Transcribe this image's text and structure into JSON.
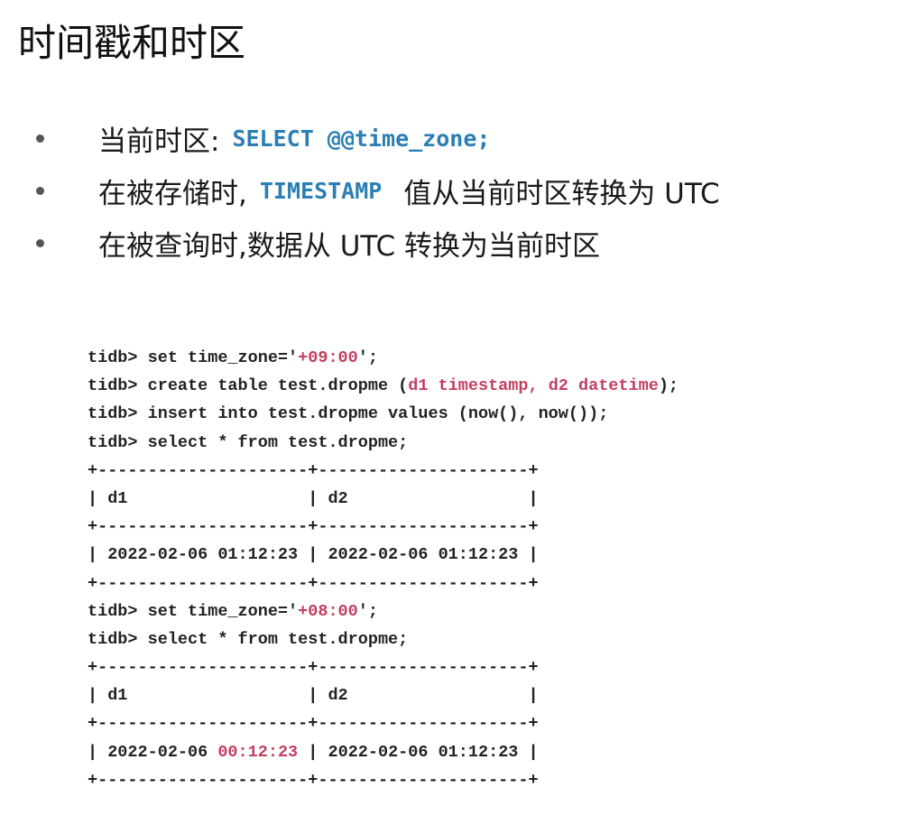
{
  "title": "时间戳和时区",
  "bullets": [
    {
      "text": "当前时区:",
      "code": "SELECT @@time_zone;",
      "after": ""
    },
    {
      "text": "在被存储时,",
      "code": "TIMESTAMP",
      "after": "值从当前时区转换为 UTC"
    },
    {
      "text": "在被查询时,数据从 UTC 转换为当前时区",
      "code": "",
      "after": ""
    }
  ],
  "code_lines": [
    [
      {
        "t": "tidb> set time_zone='"
      },
      {
        "t": "+09:00",
        "c": "pink"
      },
      {
        "t": "';"
      }
    ],
    [
      {
        "t": "tidb> create table test.dropme ("
      },
      {
        "t": "d1 timestamp, d2 datetime",
        "c": "pink"
      },
      {
        "t": ");"
      }
    ],
    [
      {
        "t": "tidb> insert into test.dropme values (now(), now());"
      }
    ],
    [
      {
        "t": "tidb> select * from test.dropme;"
      }
    ],
    [
      {
        "t": "+---------------------+---------------------+"
      }
    ],
    [
      {
        "t": "| d1                  | d2                  |"
      }
    ],
    [
      {
        "t": "+---------------------+---------------------+"
      }
    ],
    [
      {
        "t": "| 2022-02-06 01:12:23 | 2022-02-06 01:12:23 |"
      }
    ],
    [
      {
        "t": "+---------------------+---------------------+"
      }
    ],
    [
      {
        "t": "tidb> set time_zone='"
      },
      {
        "t": "+08:00",
        "c": "pink"
      },
      {
        "t": "';"
      }
    ],
    [
      {
        "t": "tidb> select * from test.dropme;"
      }
    ],
    [
      {
        "t": "+---------------------+---------------------+"
      }
    ],
    [
      {
        "t": "| d1                  | d2                  |"
      }
    ],
    [
      {
        "t": "+---------------------+---------------------+"
      }
    ],
    [
      {
        "t": "| 2022-02-06 "
      },
      {
        "t": "00:12:23",
        "c": "pink"
      },
      {
        "t": " | 2022-02-06 01:12:23 |"
      }
    ],
    [
      {
        "t": "+---------------------+---------------------+"
      }
    ]
  ]
}
